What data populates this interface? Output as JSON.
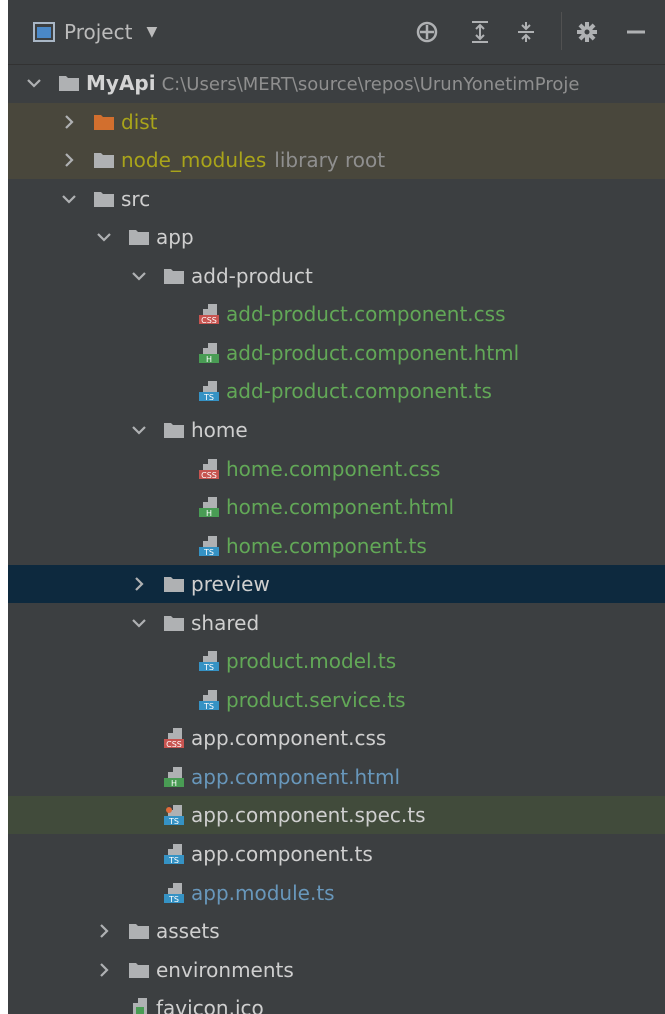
{
  "toolbar": {
    "title": "Project",
    "dropdown": "▼",
    "buttons": [
      "locate-icon",
      "expand-all-icon",
      "collapse-all-icon",
      "gear-icon",
      "minimize-icon"
    ]
  },
  "colors": {
    "background": "#3c3f41",
    "selected_row": "#0d293e",
    "excluded_row": "#49473c",
    "highlight_row": "#414b3b",
    "vcs_added": "#62a857",
    "vcs_modified": "#6897bb",
    "excluded_text": "#a9a41a"
  },
  "tree": [
    {
      "label": "MyApi",
      "path": "C:\\Users\\MERT\\source\\repos\\UrunYonetimProje",
      "icon": "folder",
      "arrow": "down",
      "depth": 0,
      "color": "bold"
    },
    {
      "label": "dist",
      "icon": "folder-excluded",
      "arrow": "right",
      "depth": 1,
      "color": "olive",
      "bg": "excluded"
    },
    {
      "label": "node_modules",
      "hint": "library root",
      "icon": "folder",
      "arrow": "right",
      "depth": 1,
      "color": "olive",
      "bg": "excluded"
    },
    {
      "label": "src",
      "icon": "folder",
      "arrow": "down",
      "depth": 1,
      "color": "default"
    },
    {
      "label": "app",
      "icon": "folder",
      "arrow": "down",
      "depth": 2,
      "color": "default"
    },
    {
      "label": "add-product",
      "icon": "folder",
      "arrow": "down",
      "depth": 3,
      "color": "default"
    },
    {
      "label": "add-product.component.css",
      "icon": "css",
      "depth": 4,
      "color": "green"
    },
    {
      "label": "add-product.component.html",
      "icon": "html",
      "depth": 4,
      "color": "green"
    },
    {
      "label": "add-product.component.ts",
      "icon": "ts",
      "depth": 4,
      "color": "green"
    },
    {
      "label": "home",
      "icon": "folder",
      "arrow": "down",
      "depth": 3,
      "color": "default"
    },
    {
      "label": "home.component.css",
      "icon": "css",
      "depth": 4,
      "color": "green"
    },
    {
      "label": "home.component.html",
      "icon": "html",
      "depth": 4,
      "color": "green"
    },
    {
      "label": "home.component.ts",
      "icon": "ts",
      "depth": 4,
      "color": "green"
    },
    {
      "label": "preview",
      "icon": "folder",
      "arrow": "right",
      "depth": 3,
      "color": "default",
      "bg": "selected"
    },
    {
      "label": "shared",
      "icon": "folder",
      "arrow": "down",
      "depth": 3,
      "color": "default"
    },
    {
      "label": "product.model.ts",
      "icon": "ts",
      "depth": 4,
      "color": "green"
    },
    {
      "label": "product.service.ts",
      "icon": "ts",
      "depth": 4,
      "color": "green"
    },
    {
      "label": "app.component.css",
      "icon": "css",
      "depth": 3,
      "color": "default"
    },
    {
      "label": "app.component.html",
      "icon": "html",
      "depth": 3,
      "color": "blue"
    },
    {
      "label": "app.component.spec.ts",
      "icon": "ts-spec",
      "depth": 3,
      "color": "default",
      "bg": "highlight"
    },
    {
      "label": "app.component.ts",
      "icon": "ts",
      "depth": 3,
      "color": "default"
    },
    {
      "label": "app.module.ts",
      "icon": "ts",
      "depth": 3,
      "color": "blue"
    },
    {
      "label": "assets",
      "icon": "folder",
      "arrow": "right",
      "depth": 2,
      "color": "default"
    },
    {
      "label": "environments",
      "icon": "folder",
      "arrow": "right",
      "depth": 2,
      "color": "default"
    },
    {
      "label": "favicon.ico",
      "icon": "file",
      "depth": 2,
      "color": "default"
    }
  ]
}
